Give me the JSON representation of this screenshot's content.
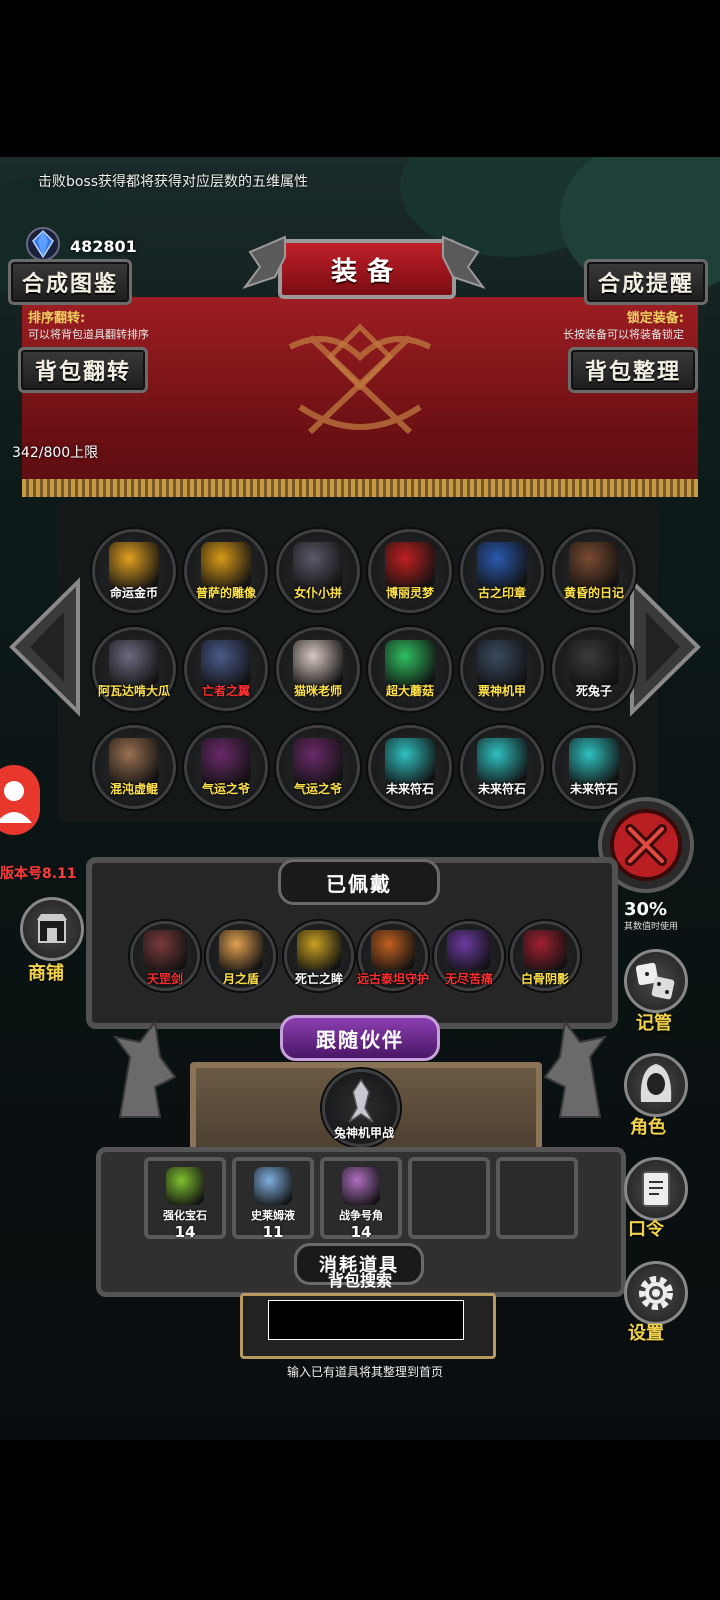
{
  "hint_text": "击败boss获得都将获得对应层数的五维属性",
  "gem_count": "482801",
  "title": "装备",
  "top_buttons": {
    "left": "合成图鉴",
    "right": "合成提醒"
  },
  "sort_note": {
    "title": "排序翻转:",
    "subtitle": "可以将背包道具翻转排序"
  },
  "lock_note": {
    "title": "锁定装备:",
    "subtitle": "长按装备可以将装备锁定"
  },
  "mid_buttons": {
    "left": "背包翻转",
    "right": "背包整理"
  },
  "capacity": "342/800上限",
  "inventory": [
    {
      "label": "命运金币",
      "color": "white",
      "art": "#e0a020"
    },
    {
      "label": "普萨的雕像",
      "color": "yellow",
      "art": "#d89a18"
    },
    {
      "label": "女仆小拼",
      "color": "yellow",
      "art": "#5a5a6a"
    },
    {
      "label": "博丽灵梦",
      "color": "yellow",
      "art": "#c02020"
    },
    {
      "label": "古之印章",
      "color": "yellow",
      "art": "#2a5ab0"
    },
    {
      "label": "黄昏的日记",
      "color": "yellow",
      "art": "#7a4a30"
    },
    {
      "label": "阿瓦达啃大瓜",
      "color": "yellow",
      "art": "#6a6a80"
    },
    {
      "label": "亡者之翼",
      "color": "red",
      "art": "#4a5a8a"
    },
    {
      "label": "猫咪老师",
      "color": "yellow",
      "art": "#d8c8c0"
    },
    {
      "label": "超大蘑菇",
      "color": "yellow",
      "art": "#30c060"
    },
    {
      "label": "票神机甲",
      "color": "yellow",
      "art": "#3a4a60"
    },
    {
      "label": "死兔子",
      "color": "white",
      "art": "#3a3a3a"
    },
    {
      "label": "混沌虚鲲",
      "color": "yellow",
      "art": "#9a7050"
    },
    {
      "label": "气运之爷",
      "color": "yellow",
      "art": "#6a2a6a"
    },
    {
      "label": "气运之爷",
      "color": "yellow",
      "art": "#6a2a6a"
    },
    {
      "label": "未来符石",
      "color": "white",
      "art": "#30c0c0"
    },
    {
      "label": "未来符石",
      "color": "white",
      "art": "#30c0c0"
    },
    {
      "label": "未来符石",
      "color": "white",
      "art": "#30c0c0"
    }
  ],
  "version": "版本号8.11",
  "equipped_title": "已佩戴",
  "equipped": [
    {
      "label": "天罡剑",
      "color": "red",
      "art": "#7a3a3a"
    },
    {
      "label": "月之盾",
      "color": "yellow",
      "art": "#e0a050"
    },
    {
      "label": "死亡之眸",
      "color": "white",
      "art": "#c8a020"
    },
    {
      "label": "远古泰坦守护",
      "color": "red",
      "art": "#c06020"
    },
    {
      "label": "无尽苦痛",
      "color": "red",
      "art": "#6a3aa0"
    },
    {
      "label": "白骨阴影",
      "color": "yellow",
      "art": "#a02030"
    }
  ],
  "right_counter": "30%",
  "right_counter_sub": "其数值时使用",
  "companion_title": "跟随伙伴",
  "companion": {
    "label": "兔神机甲战"
  },
  "consumables_title": "消耗道具",
  "consumables": [
    {
      "label": "强化宝石",
      "count": "14",
      "art": "#80c030"
    },
    {
      "label": "史莱姆液",
      "count": "11",
      "art": "#80b0e0"
    },
    {
      "label": "战争号角",
      "count": "14",
      "art": "#b070c0"
    },
    {
      "label": "",
      "count": "",
      "art": ""
    },
    {
      "label": "",
      "count": "",
      "art": ""
    }
  ],
  "search": {
    "title": "背包搜索",
    "value": "",
    "hint": "输入已有道具将其整理到首页"
  },
  "side_menu": {
    "shop": "商铺",
    "manage": "记管",
    "role": "角色",
    "code": "口令",
    "settings": "设置"
  },
  "icons": [
    "gem-icon",
    "left-arrow-icon",
    "right-arrow-icon",
    "close-icon",
    "avatar-icon",
    "shop-icon",
    "dice-icon",
    "hood-icon",
    "scroll-icon",
    "gear-icon"
  ]
}
